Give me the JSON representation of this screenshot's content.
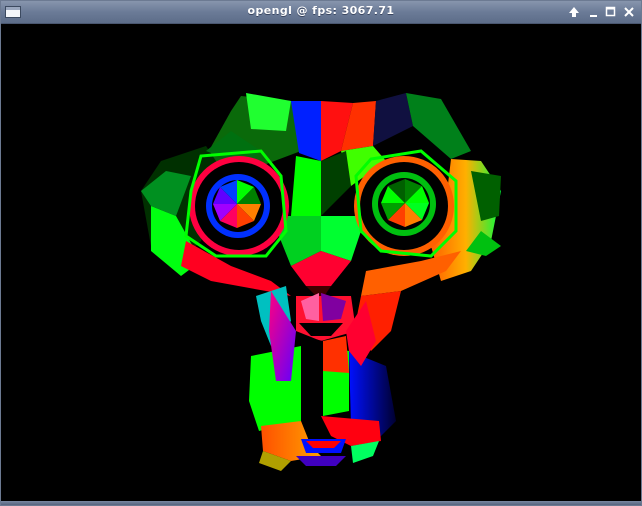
{
  "window": {
    "title": "opengl @ fps: 3067.71",
    "buttons": {
      "up": "up-arrow-icon",
      "minimize": "minimize-icon",
      "maximize": "maximize-icon",
      "close": "close-icon"
    },
    "titlebar_color": "#6b7b97",
    "viewport_background": "#000000"
  },
  "scene": {
    "object": "suzanne-monkey-head-icon",
    "palette": [
      "#ff0000",
      "#00ff00",
      "#0000ff",
      "#ff8000",
      "#8000ff",
      "#00ffff",
      "#ff00ff"
    ]
  }
}
